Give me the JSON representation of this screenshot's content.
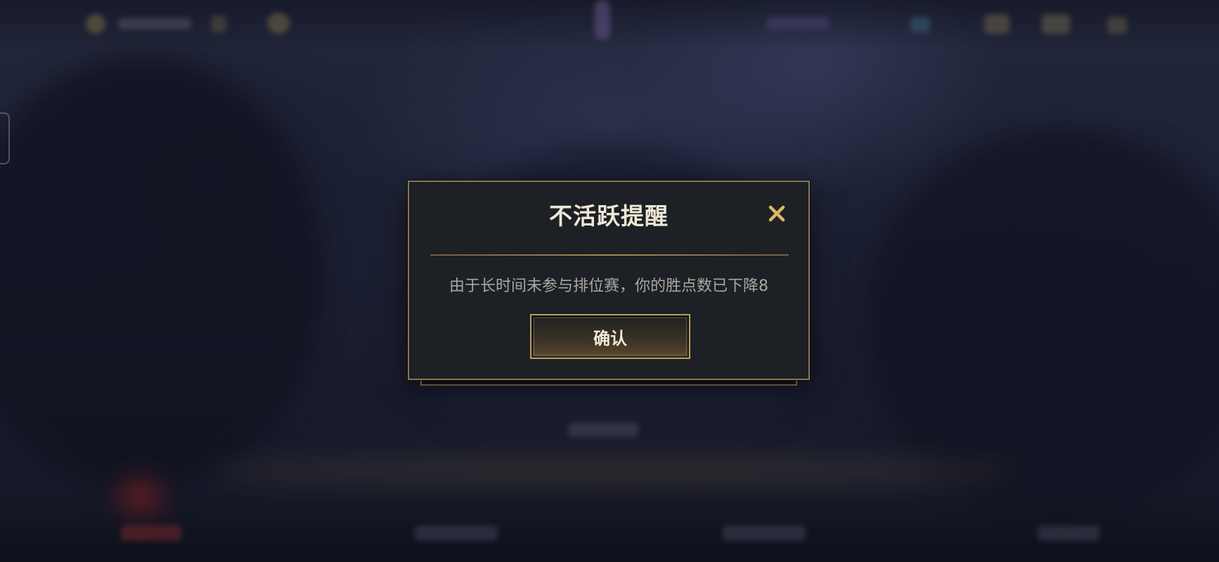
{
  "dialog": {
    "title": "不活跃提醒",
    "message": "由于长时间未参与排位赛，你的胜点数已下降8",
    "confirm_label": "确认",
    "close_icon": "close-icon"
  },
  "colors": {
    "accent_gold": "#b79d67",
    "close_gold": "#d8b865",
    "dialog_bg": "#1d2024"
  }
}
